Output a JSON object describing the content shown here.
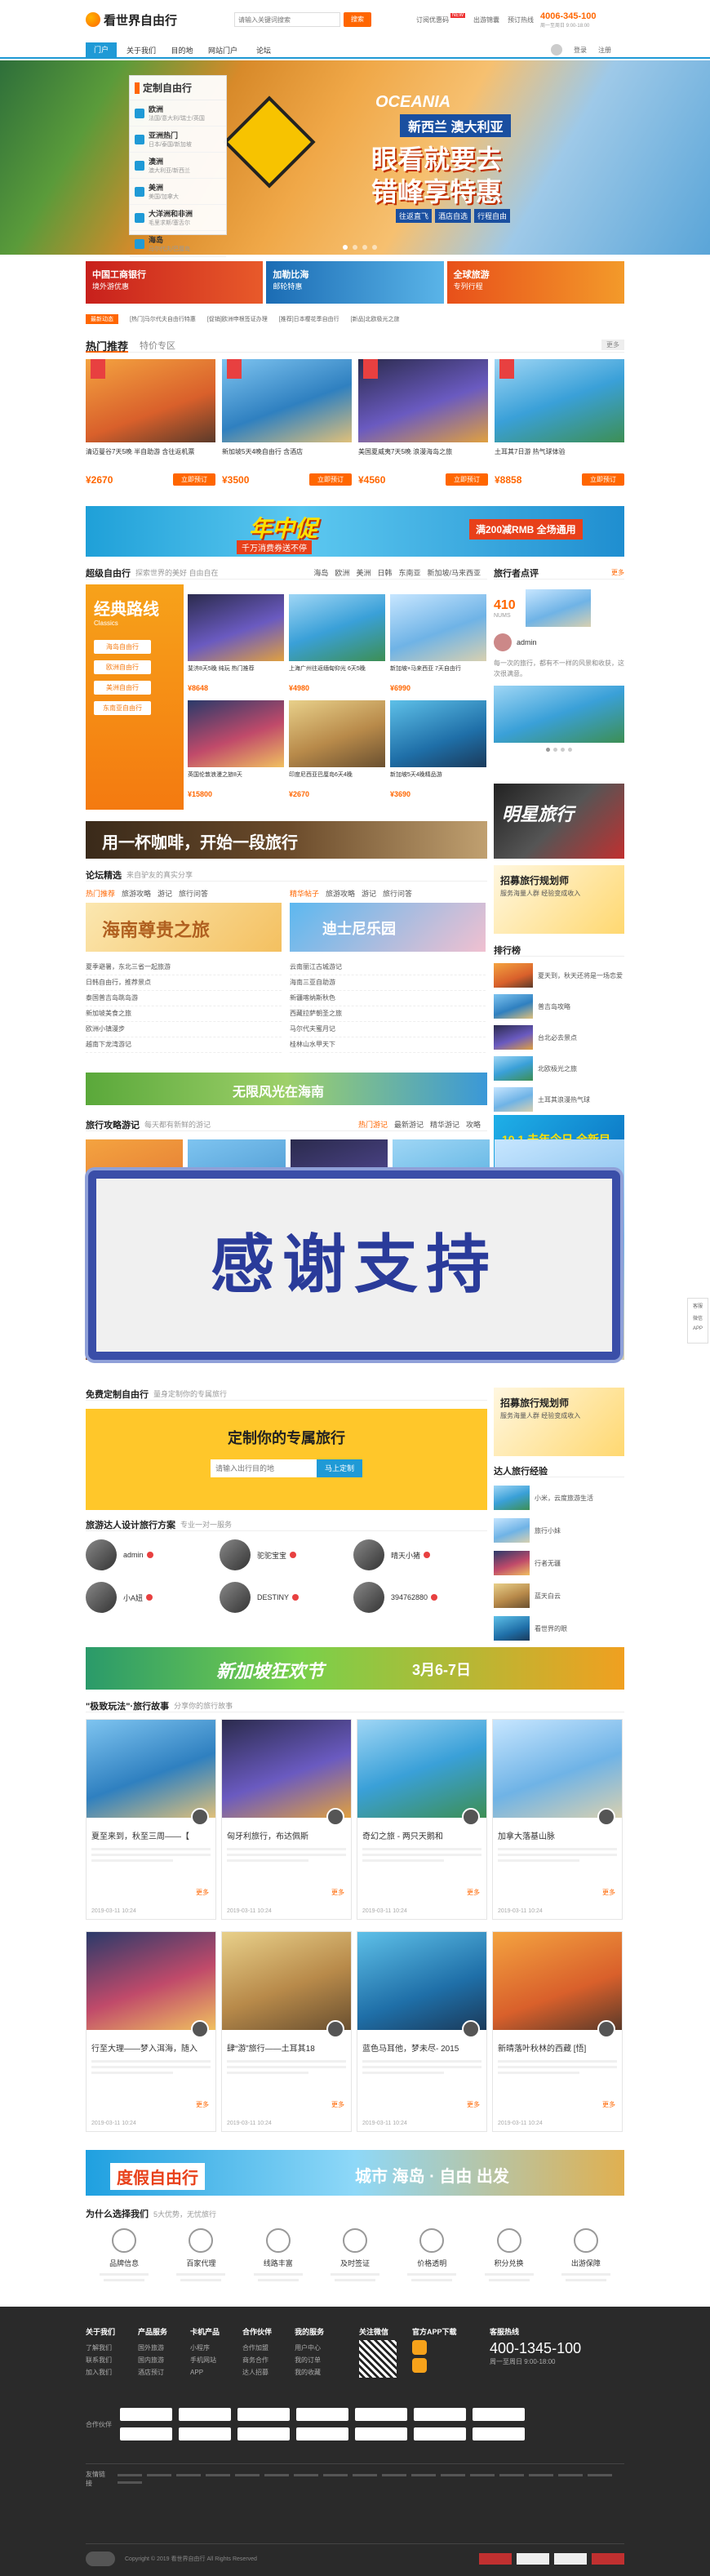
{
  "header": {
    "logo": "看世界自由行",
    "search_placeholder": "请输入关键词搜索",
    "search_btn": "搜索",
    "links": [
      "订阅优惠码",
      "出游锦囊",
      "预订热线"
    ],
    "hotline": "4006-345-100",
    "hotline_sub": "周一至周日 9:00-18:00",
    "badge": "NEW"
  },
  "nav": {
    "items": [
      "门户",
      "关于我们",
      "目的地",
      "自由行",
      "旅游攻略",
      "网站门户",
      "论坛",
      "游记",
      "攻略",
      "签证"
    ],
    "user": [
      "登录",
      "注册"
    ]
  },
  "sidebar": {
    "title": "定制自由行",
    "items": [
      {
        "name": "欧洲",
        "sub": "法国/意大利/瑞士/英国"
      },
      {
        "name": "亚洲热门",
        "sub": "日本/泰国/新加坡"
      },
      {
        "name": "澳洲",
        "sub": "澳大利亚/新西兰"
      },
      {
        "name": "美洲",
        "sub": "美国/加拿大"
      },
      {
        "name": "大洋洲和非洲",
        "sub": "毛里求斯/塞舌尔"
      },
      {
        "name": "海岛",
        "sub": "马尔代夫/巴厘岛"
      }
    ]
  },
  "banner": {
    "line1": "OCEANIA",
    "line2": "新西兰 澳大利亚",
    "line3": "眼看就要去",
    "line4": "错峰享特惠",
    "tags": [
      "往返直飞",
      "酒店自选",
      "行程自由"
    ]
  },
  "promo": [
    {
      "title": "中国工商银行",
      "sub": "境外游优惠"
    },
    {
      "title": "加勒比海",
      "sub": "邮轮特惠"
    },
    {
      "title": "全球旅游",
      "sub": "专列行程"
    }
  ],
  "ticker": {
    "label": "最新动态",
    "items": [
      "[热门]马尔代夫自由行特惠",
      "[促销]欧洲申根签证办理",
      "[推荐]日本樱花季自由行",
      "[新品]北欧极光之旅"
    ]
  },
  "hot": {
    "title": "热门推荐",
    "tab2": "特价专区",
    "more": "更多",
    "items": [
      {
        "name": "清迈曼谷7天5晚 半自助游 含往返机票",
        "price": "¥2670",
        "btn": "立即预订"
      },
      {
        "name": "新加坡5天4晚自由行 含酒店",
        "price": "¥3500",
        "btn": "立即预订"
      },
      {
        "name": "美国夏威夷7天5晚 浪漫海岛之旅",
        "price": "¥4560",
        "btn": "立即预订"
      },
      {
        "name": "土耳其7日游 热气球体验",
        "price": "¥8858",
        "btn": "立即预订"
      }
    ]
  },
  "ad1": {
    "text": "年中促",
    "sub": "千万消费券送不停",
    "right": "满200减RMB 全场通用"
  },
  "super": {
    "title": "超级自由行",
    "sub": "探索世界的美好 自由自在",
    "tabs": [
      "海岛",
      "欧洲",
      "美洲",
      "日韩",
      "东南亚",
      "新加坡/马来西亚"
    ],
    "left_title": "经典路线",
    "left_sub": "Classics",
    "left_tags": [
      "海岛自由行",
      "欧洲自由行",
      "美洲自由行",
      "东南亚自由行"
    ],
    "items": [
      {
        "name": "斐济8天5晚 纯玩 热门推荐",
        "price": "¥8648"
      },
      {
        "name": "上海广州往返缅甸仰光 6天5晚",
        "price": "¥4980"
      },
      {
        "name": "新加坡+马来西亚 7天自由行",
        "price": "¥6990"
      },
      {
        "name": "英国伦敦浪漫之旅8天",
        "price": "¥15800"
      },
      {
        "name": "印度尼西亚巴厘岛6天4晚",
        "price": "¥2670"
      },
      {
        "name": "新加坡5天4晚精品游",
        "price": "¥3690"
      }
    ]
  },
  "review": {
    "title": "旅行者点评",
    "more": "更多",
    "count": "410",
    "unit": "NUMS",
    "user": "admin",
    "text": "每一次的旅行，都有不一样的风景和收获，这次很满意。"
  },
  "coffee": {
    "text": "用一杯咖啡，开始一段旅行"
  },
  "star": {
    "text": "明星旅行"
  },
  "forum": {
    "title": "论坛精选",
    "sub": "来自驴友的真实分享",
    "tabs": [
      "热门推荐",
      "旅游攻略",
      "游记",
      "旅行问答"
    ],
    "tab2": [
      "精华帖子",
      "旅游攻略",
      "游记",
      "旅行问答"
    ],
    "img1": "海南尊贵之旅",
    "img2": "迪士尼乐园",
    "left_list": [
      "夏季避暑，东北三省一起旅游",
      "日韩自由行，推荐景点",
      "泰国普吉岛跳岛游",
      "新加坡美食之旅",
      "欧洲小镇漫步",
      "越南下龙湾游记"
    ],
    "right_list": [
      "云南丽江古城游记",
      "海南三亚自助游",
      "新疆喀纳斯秋色",
      "西藏拉萨朝圣之旅",
      "马尔代夫蜜月记",
      "桂林山水甲天下"
    ]
  },
  "recruit": {
    "title": "招募旅行规划师",
    "sub": "服务海量人群 经验变成收入"
  },
  "rank": {
    "title": "排行榜",
    "items": [
      "夏天到，秋天还将是一场恋爱",
      "普吉岛攻略",
      "台北必去景点",
      "北欧极光之旅",
      "土耳其浪漫热气球"
    ]
  },
  "ad2": {
    "text": "无限风光在海南"
  },
  "ad3": {
    "text": "10.1 去年今日 全新目的地"
  },
  "travelnotes": {
    "title": "旅行攻略游记",
    "sub": "每天都有新鲜的游记",
    "tabs": [
      "热门游记",
      "最新游记",
      "精华游记",
      "攻略"
    ]
  },
  "overlay": {
    "text": "感谢支持"
  },
  "custom": {
    "title": "免费定制自由行",
    "sub": "量身定制你的专属旅行",
    "banner": "定制你的专属旅行",
    "placeholder": "请输入出行目的地",
    "btn": "马上定制"
  },
  "planners": {
    "title": "旅游达人设计旅行方案",
    "sub": "专业一对一服务",
    "people": [
      {
        "name": "admin"
      },
      {
        "name": "驼驼宝宝"
      },
      {
        "name": "晴天小猪"
      },
      {
        "name": "小A妞"
      },
      {
        "name": "DESTINY"
      },
      {
        "name": "394762880"
      }
    ]
  },
  "expert": {
    "title": "达人旅行经验",
    "items": [
      "小米，云度旅游生活",
      "旅行小妹",
      "行者无疆",
      "蓝天白云",
      "看世界的眼",
      "背包客"
    ]
  },
  "ad4": {
    "text": "新加坡狂欢节",
    "date": "3月6-7日"
  },
  "stories": {
    "title": "\"极致玩法\"·旅行故事",
    "sub": "分享你的旅行故事",
    "items": [
      {
        "title": "夏至来到，秋至三周——【",
        "date": "2019-03-11 10:24",
        "btn": "更多"
      },
      {
        "title": "匈牙利旅行，布达佩斯",
        "date": "2019-03-11 10:24",
        "btn": "更多"
      },
      {
        "title": "奇幻之旅 - 两只天鹅和",
        "date": "2019-03-11 10:24",
        "btn": "更多"
      },
      {
        "title": "加拿大落基山脉",
        "date": "2019-03-11 10:24",
        "btn": "更多"
      },
      {
        "title": "行至大理——梦入洱海，随入",
        "date": "2019-03-11 10:24",
        "btn": "更多"
      },
      {
        "title": "肆“游”旅行——土耳其18",
        "date": "2019-03-11 10:24",
        "btn": "更多"
      },
      {
        "title": "蓝色马耳他，梦未尽- 2015",
        "date": "2019-03-11 10:24",
        "btn": "更多"
      },
      {
        "title": "新晴落叶秋林的西藏 [悟]",
        "date": "2019-03-11 10:24",
        "btn": "更多"
      }
    ]
  },
  "ad5": {
    "left": "度假自由行",
    "right": "城市 海岛 · 自由 出发"
  },
  "why": {
    "title": "为什么选择我们",
    "sub": "5大优势，无忧旅行",
    "items": [
      "品牌信息",
      "百家代理",
      "线路丰富",
      "及时签证",
      "价格透明",
      "积分兑换",
      "出游保障"
    ]
  },
  "footer": {
    "cols": [
      {
        "h": "关于我们",
        "items": [
          "了解我们",
          "联系我们",
          "加入我们"
        ]
      },
      {
        "h": "产品服务",
        "items": [
          "国外旅游",
          "国内旅游",
          "酒店预订"
        ]
      },
      {
        "h": "卡机产品",
        "items": [
          "小程序",
          "手机网站",
          "APP"
        ]
      },
      {
        "h": "合作伙伴",
        "items": [
          "合作加盟",
          "商务合作",
          "达人招募"
        ]
      },
      {
        "h": "我的服务",
        "items": [
          "用户中心",
          "我的订单",
          "我的收藏"
        ]
      }
    ],
    "qr": "关注微信",
    "app": "官方APP下载",
    "phone_label": "客服热线",
    "phone": "400-1345-100",
    "phone_sub": "周一至周日 9:00-18:00",
    "partners_label": "合作伙伴",
    "friends_label": "友情链接",
    "copyright": "Copyright © 2019 看世界自由行 All Rights Reserved"
  },
  "side_float": [
    "客服",
    "微信",
    "APP"
  ]
}
